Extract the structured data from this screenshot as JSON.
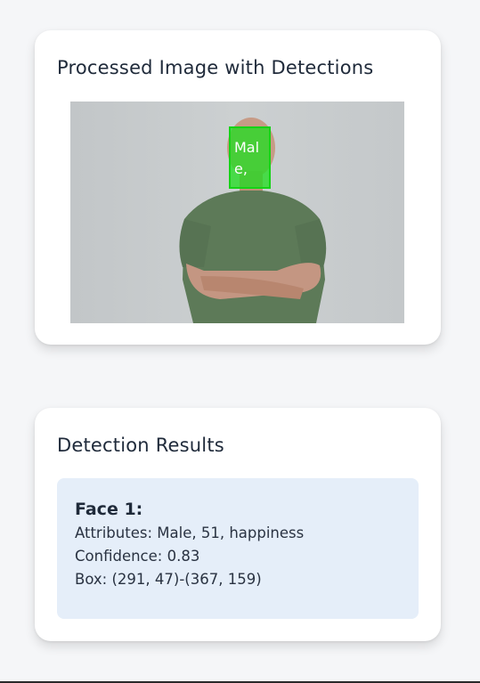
{
  "processed_card": {
    "title": "Processed Image with Detections",
    "detection_label": "Male,"
  },
  "results_card": {
    "title": "Detection Results",
    "face": {
      "heading": "Face 1:",
      "attributes": "Attributes: Male, 51, happiness",
      "confidence": "Confidence: 0.83",
      "box": "Box: (291, 47)-(367, 159)"
    }
  },
  "colors": {
    "detection_box": "#22dc22",
    "result_panel": "#e5eef9",
    "shirt": "#5d7a58"
  }
}
